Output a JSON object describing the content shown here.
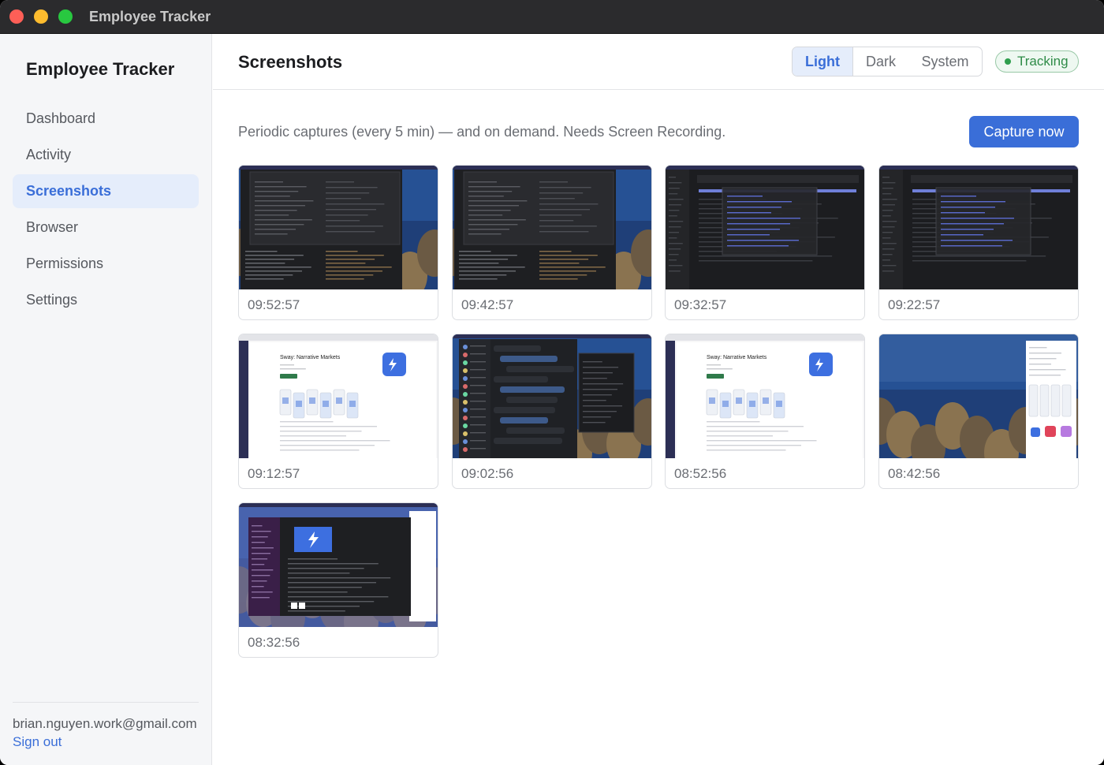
{
  "window": {
    "title": "Employee Tracker"
  },
  "sidebar": {
    "brand": "Employee Tracker",
    "items": [
      {
        "label": "Dashboard",
        "active": false
      },
      {
        "label": "Activity",
        "active": false
      },
      {
        "label": "Screenshots",
        "active": true
      },
      {
        "label": "Browser",
        "active": false
      },
      {
        "label": "Permissions",
        "active": false
      },
      {
        "label": "Settings",
        "active": false
      }
    ],
    "email": "brian.nguyen.work@gmail.com",
    "signout_label": "Sign out"
  },
  "header": {
    "title": "Screenshots",
    "theme_options": [
      "Light",
      "Dark",
      "System"
    ],
    "theme_selected": "Light",
    "status_label": "Tracking"
  },
  "content": {
    "description": "Periodic captures (every 5 min) — and on demand. Needs Screen Recording.",
    "capture_label": "Capture now",
    "screenshots": [
      {
        "time": "09:52:57",
        "kind": "dark-coral"
      },
      {
        "time": "09:42:57",
        "kind": "dark-coral"
      },
      {
        "time": "09:32:57",
        "kind": "dark-full"
      },
      {
        "time": "09:22:57",
        "kind": "dark-full"
      },
      {
        "time": "09:12:57",
        "kind": "light-app",
        "app_title": "Sway: Narrative Markets"
      },
      {
        "time": "09:02:56",
        "kind": "dark-chat"
      },
      {
        "time": "08:52:56",
        "kind": "light-app",
        "app_title": "Sway: Narrative Markets"
      },
      {
        "time": "08:42:56",
        "kind": "coral-phone"
      },
      {
        "time": "08:32:56",
        "kind": "purple-app"
      }
    ]
  }
}
